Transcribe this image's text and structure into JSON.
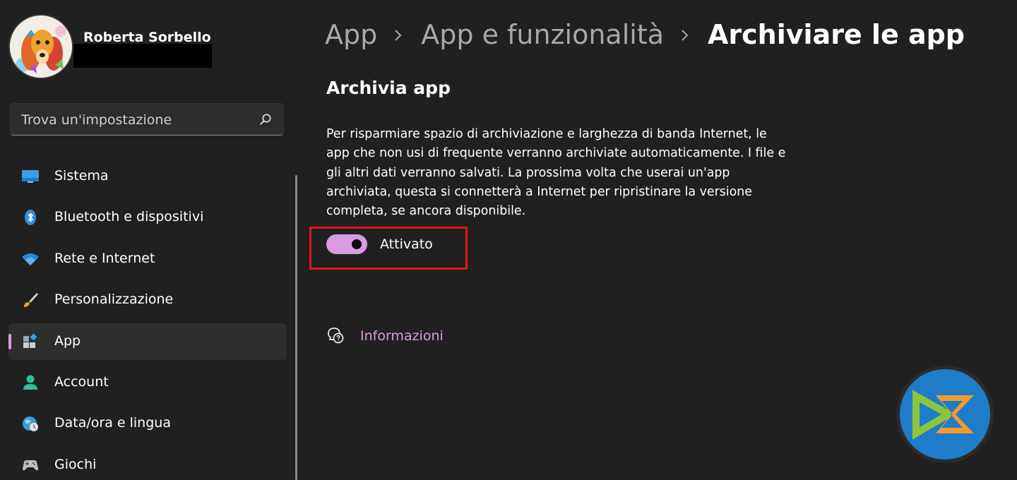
{
  "profile": {
    "name": "Roberta Sorbello"
  },
  "search": {
    "placeholder": "Trova un'impostazione",
    "icon": "search-icon"
  },
  "sidebar": {
    "items": [
      {
        "label": "Sistema",
        "icon": "system-display-icon",
        "selected": false
      },
      {
        "label": "Bluetooth e dispositivi",
        "icon": "bluetooth-icon",
        "selected": false
      },
      {
        "label": "Rete e Internet",
        "icon": "wifi-icon",
        "selected": false
      },
      {
        "label": "Personalizzazione",
        "icon": "paintbrush-icon",
        "selected": false
      },
      {
        "label": "App",
        "icon": "apps-icon",
        "selected": true
      },
      {
        "label": "Account",
        "icon": "account-icon",
        "selected": false
      },
      {
        "label": "Data/ora e lingua",
        "icon": "time-language-icon",
        "selected": false
      },
      {
        "label": "Giochi",
        "icon": "gamepad-icon",
        "selected": false
      }
    ]
  },
  "breadcrumb": {
    "items": [
      "App",
      "App e funzionalità",
      "Archiviare le app"
    ]
  },
  "main": {
    "section_title": "Archivia app",
    "description": "Per risparmiare spazio di archiviazione e larghezza di banda Internet, le app che non usi di frequente verranno archiviate automaticamente. I file e gli altri dati verranno salvati. La prossima volta che userai un'app archiviata, questa si connetterà a Internet per ripristinare la versione completa, se ancora disponibile.",
    "toggle": {
      "label": "Attivato",
      "on": true
    },
    "info_link": "Informazioni"
  },
  "colors": {
    "background": "#202020",
    "accent": "#d99bdf",
    "highlight": "#e3141b",
    "selected_item": "#2d2d2d",
    "breadcrumb_inactive": "#a8a8a8"
  }
}
